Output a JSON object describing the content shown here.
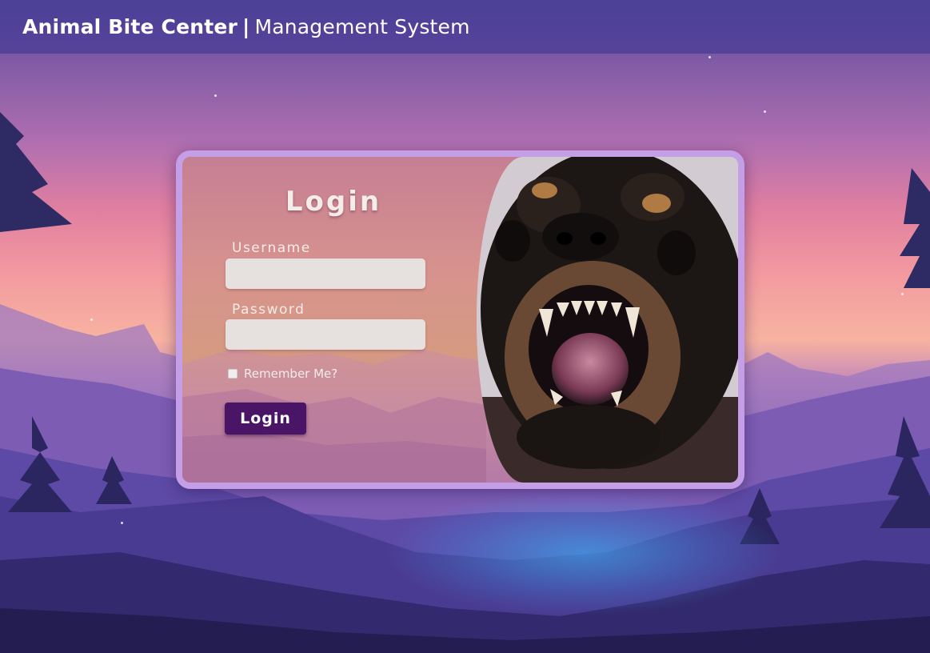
{
  "header": {
    "brand_bold": "Animal Bite Center",
    "separator": "|",
    "brand_light": "Management System"
  },
  "login": {
    "title": "Login",
    "username_label": "Username",
    "username_value": "",
    "password_label": "Password",
    "password_value": "",
    "remember_label": "Remember Me?",
    "remember_checked": false,
    "submit_label": "Login"
  },
  "colors": {
    "accent": "#4a1566",
    "card_border": "#c59ee8",
    "topbar": "#463c96"
  },
  "images": {
    "side_photo": "snarling-dog-photo",
    "background": "purple-mountain-forest-landscape"
  }
}
